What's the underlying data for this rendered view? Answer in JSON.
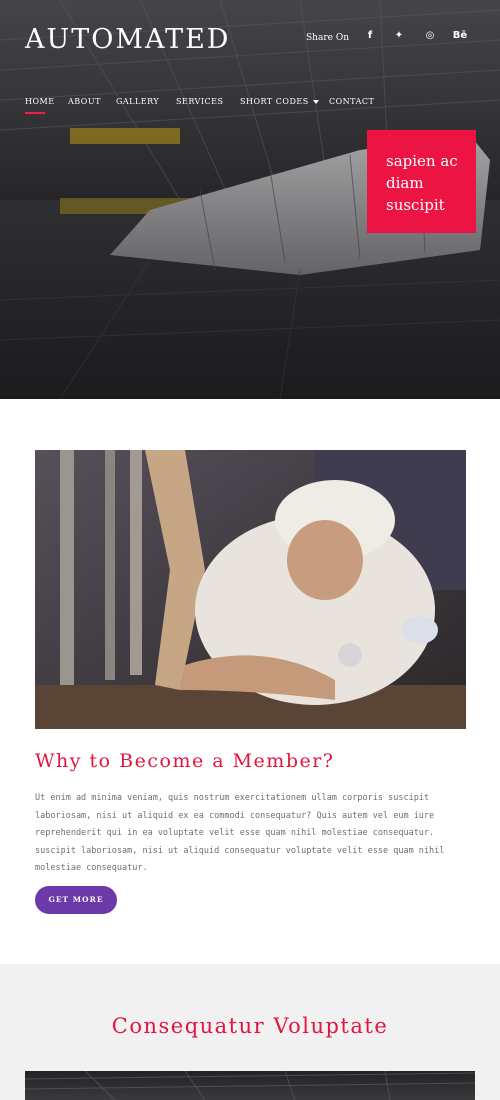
{
  "header": {
    "logo": "AUTOMATED",
    "share_label": "Share On",
    "social": [
      {
        "icon": "facebook-icon",
        "glyph": "f"
      },
      {
        "icon": "twitter-icon",
        "glyph": "✦"
      },
      {
        "icon": "dribbble-icon",
        "glyph": "◎"
      },
      {
        "icon": "behance-icon",
        "glyph": "Bē"
      }
    ]
  },
  "nav": {
    "items": [
      "HOME",
      "ABOUT",
      "GALLERY",
      "SERVICES",
      "SHORT CODES",
      "CONTACT"
    ]
  },
  "hero": {
    "caption": "sapien ac diam suscipit"
  },
  "member": {
    "title": "Why to Become a Member?",
    "text": "Ut enim ad minima veniam, quis nostrum exercitationem ullam corporis suscipit laboriosam, nisi ut aliquid ex ea commodi consequatur? Quis autem vel eum iure reprehenderit qui in ea voluptate velit esse quam nihil molestiae consequatur. suscipit laboriosam, nisi ut aliquid consequatur voluptate velit esse quam nihil molestiae consequatur.",
    "button": "GET MORE"
  },
  "section2": {
    "title": "Consequatur Voluptate"
  },
  "colors": {
    "accent": "#e3153f",
    "button": "#6c3aa8",
    "caption_box": "#ec1443"
  }
}
